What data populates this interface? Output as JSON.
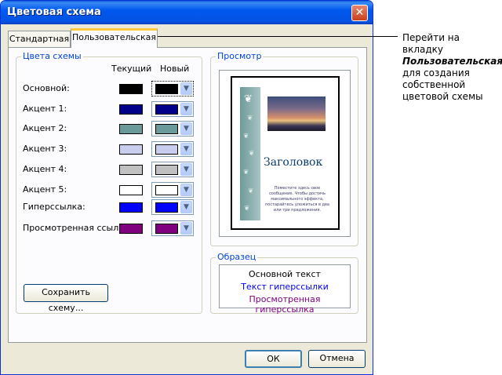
{
  "dialog": {
    "title": "Цветовая схема",
    "close_glyph": "✕",
    "tabs": [
      {
        "label": "Стандартная"
      },
      {
        "label": "Пользовательская"
      }
    ],
    "scheme_colors": {
      "legend": "Цвета схемы",
      "col_current": "Текущий",
      "col_new": "Новый",
      "rows": [
        {
          "label": "Основной:",
          "current": "#000000",
          "new": "#000000"
        },
        {
          "label": "Акцент 1:",
          "current": "#00008b",
          "new": "#00008b"
        },
        {
          "label": "Акцент 2:",
          "current": "#6a9a99",
          "new": "#6a9a99"
        },
        {
          "label": "Акцент 3:",
          "current": "#c9cdee",
          "new": "#c9cdee"
        },
        {
          "label": "Акцент 4:",
          "current": "#c0c0c0",
          "new": "#c0c0c0"
        },
        {
          "label": "Акцент 5:",
          "current": "#ffffff",
          "new": "#ffffff"
        },
        {
          "label": "Гиперссылка:",
          "current": "#0000ff",
          "new": "#0000ff"
        },
        {
          "label": "Просмотренная ссылка:",
          "current": "#800080",
          "new": "#800080"
        }
      ],
      "dropdown_icon": "chevron-down-icon",
      "save_button": "Сохранить схему..."
    },
    "preview": {
      "legend": "Просмотр",
      "heading": "Заголовок",
      "body_text": "Поместите здесь свое сообщение. Чтобы достичь максимального эффекта, постарайтесь уложиться в два или три предложения.",
      "stripe_color": "#6f9a99",
      "leaf_icon": "leaf-icon"
    },
    "sample": {
      "legend": "Образец",
      "body_text": "Основной текст",
      "hyperlink_text": "Текст гиперссылки",
      "visited_text": "Просмотренная гиперссылка",
      "body_color": "#000000",
      "hyperlink_color": "#0000ff",
      "visited_color": "#800080"
    },
    "ok_button": "ОК",
    "cancel_button": "Отмена"
  },
  "annotation": {
    "line1": "Перейти на вкладку",
    "line2": "Пользовательская",
    "line3": "для создания собственной цветовой схемы"
  }
}
